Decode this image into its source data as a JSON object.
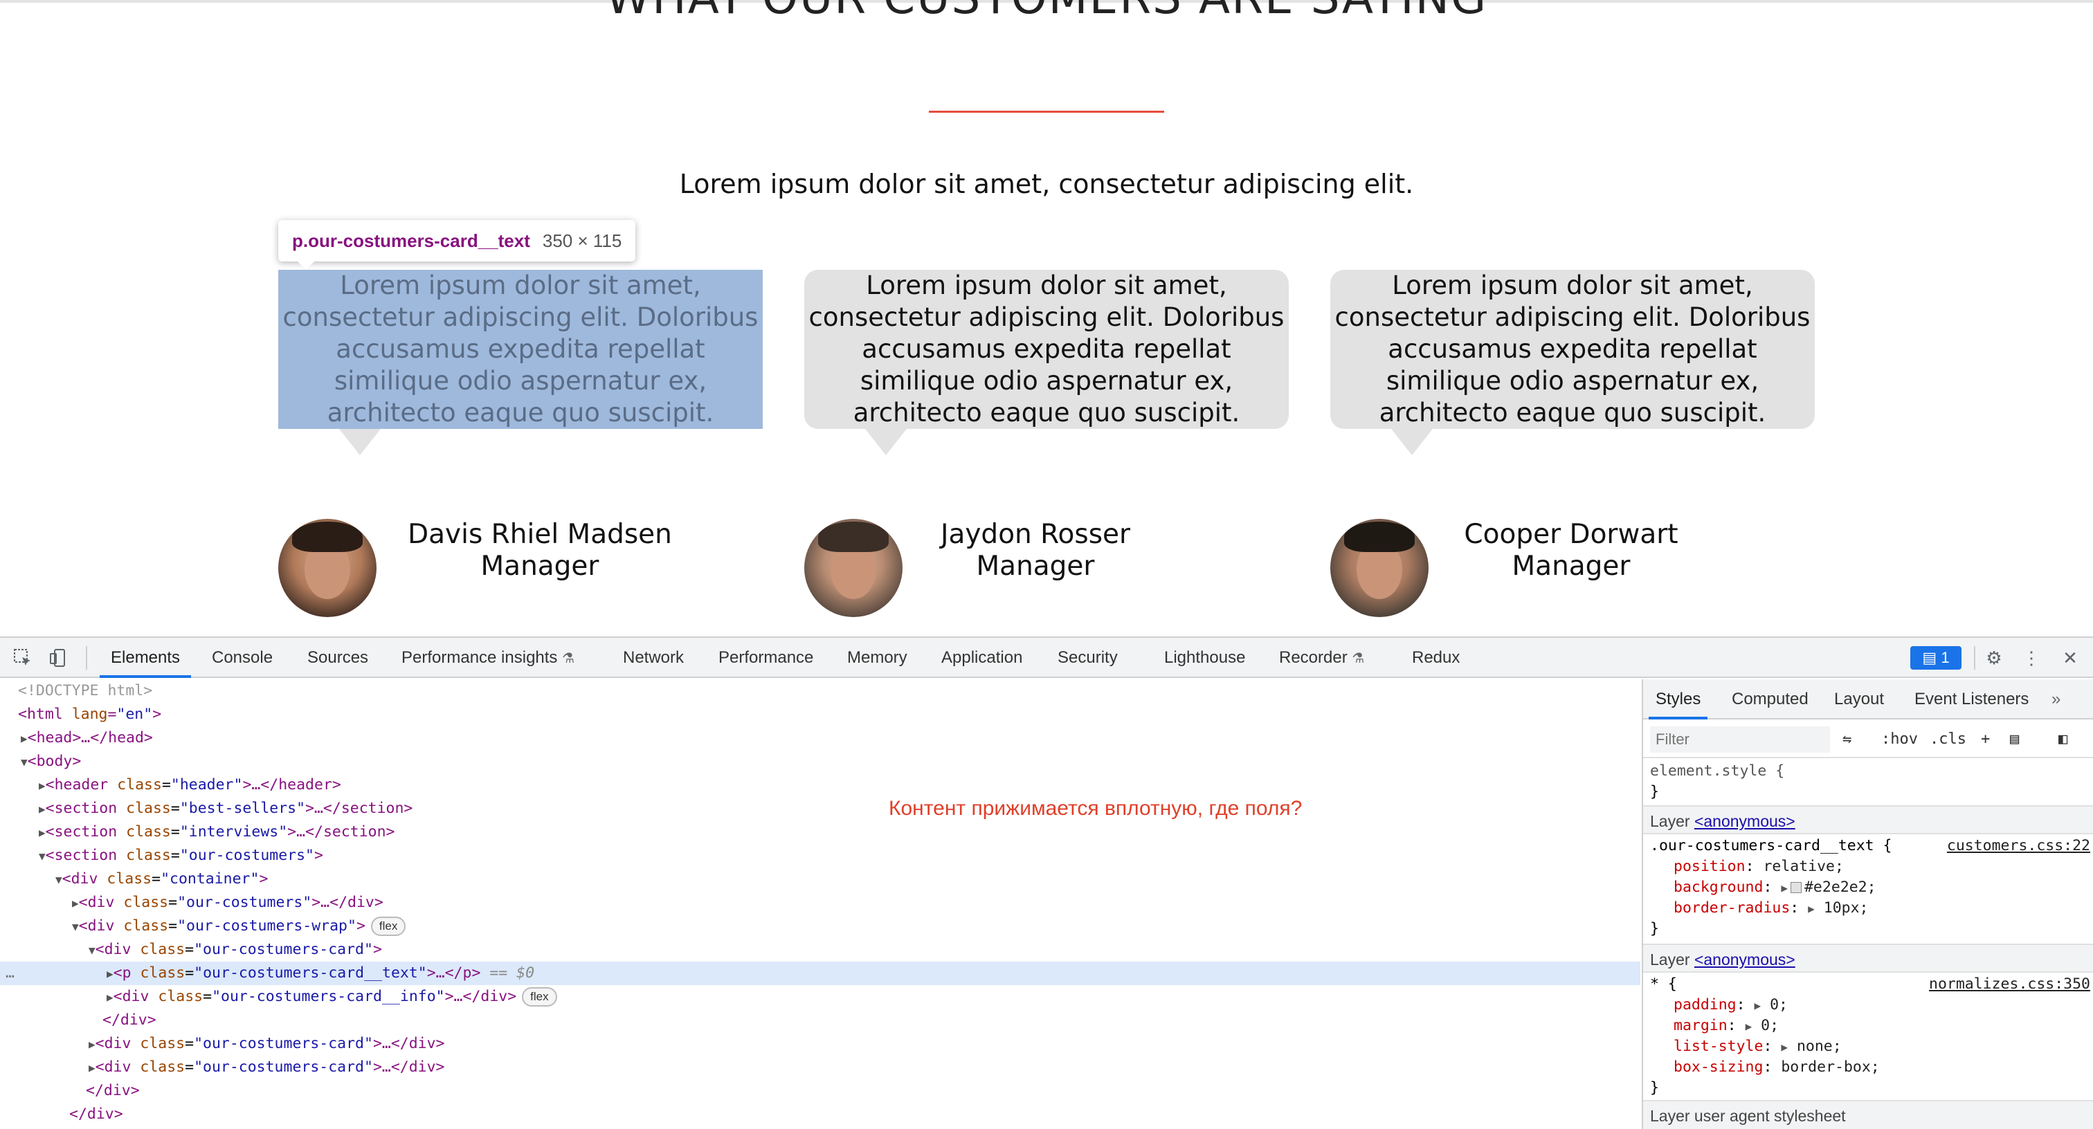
{
  "page": {
    "heading": "WHAT OUR CUSTOMERS ARE SAYING",
    "subtitle": "Lorem ipsum dolor sit amet, consectetur adipiscing elit.",
    "accent_color": "#e74c3c",
    "card_background": "#e2e2e2",
    "tooltip": {
      "selector": "p.our-costumers-card__text",
      "size": "350 × 115"
    },
    "cards": [
      {
        "text_lines": [
          "Lorem ipsum dolor sit amet,",
          "consectetur adipiscing elit. Doloribus",
          "accusamus expedita repellat",
          "similique odio aspernatur ex,",
          "architecto eaque quo suscipit."
        ],
        "name": "Davis Rhiel Madsen",
        "role": "Manager"
      },
      {
        "text_lines": [
          "Lorem ipsum dolor sit amet,",
          "consectetur adipiscing elit. Doloribus",
          "accusamus expedita repellat",
          "similique odio aspernatur ex,",
          "architecto eaque quo suscipit."
        ],
        "name": "Jaydon Rosser",
        "role": "Manager"
      },
      {
        "text_lines": [
          "Lorem ipsum dolor sit amet,",
          "consectetur adipiscing elit. Doloribus",
          "accusamus expedita repellat",
          "similique odio aspernatur ex,",
          "architecto eaque quo suscipit."
        ],
        "name": "Cooper Dorwart",
        "role": "Manager"
      }
    ]
  },
  "devtools": {
    "tabs": [
      "Elements",
      "Console",
      "Sources",
      "Performance insights",
      "Network",
      "Performance",
      "Memory",
      "Application",
      "Security",
      "Lighthouse",
      "Recorder",
      "Redux"
    ],
    "active_tab": "Elements",
    "issues_count": "1",
    "note": "Контент прижимается вплотную, где поля?",
    "dom": {
      "doctype": "<!DOCTYPE html>",
      "html_open": "html",
      "html_attr": "lang",
      "html_val": "\"en\"",
      "head": "<head>…</head>",
      "body": "<body>",
      "header_class": "\"header\"",
      "best_sellers_class": "\"best-sellers\"",
      "interviews_class": "\"interviews\"",
      "our_costumers_class": "\"our-costumers\"",
      "container_class": "\"container\"",
      "inner_class": "\"our-costumers\"",
      "wrap_class": "\"our-costumers-wrap\"",
      "card_class": "\"our-costumers-card\"",
      "card_text_class": "\"our-costumers-card__text\"",
      "card_info_class": "\"our-costumers-card__info\"",
      "selected_marker": "== $0",
      "flex_pill": "flex"
    },
    "styles": {
      "tabs": [
        "Styles",
        "Computed",
        "Layout",
        "Event Listeners"
      ],
      "active_tab": "Styles",
      "filter_placeholder": "Filter",
      "hov": ":hov",
      "cls": ".cls",
      "element_style": "element.style {",
      "close_brace": "}",
      "layer_label": "Layer",
      "layer_link": "<anonymous>",
      "rule1": {
        "selector": ".our-costumers-card__text {",
        "source": "customers.css:22",
        "props": [
          {
            "name": "position",
            "value": "relative;"
          },
          {
            "name": "background",
            "value": "#e2e2e2;"
          },
          {
            "name": "border-radius",
            "value": "10px;"
          }
        ]
      },
      "rule2": {
        "selector": "* {",
        "source": "normalizes.css:350",
        "props": [
          {
            "name": "padding",
            "value": "0;"
          },
          {
            "name": "margin",
            "value": "0;"
          },
          {
            "name": "list-style",
            "value": "none;"
          },
          {
            "name": "box-sizing",
            "value": "border-box;"
          }
        ]
      },
      "user_agent": "Layer user agent stylesheet"
    }
  }
}
